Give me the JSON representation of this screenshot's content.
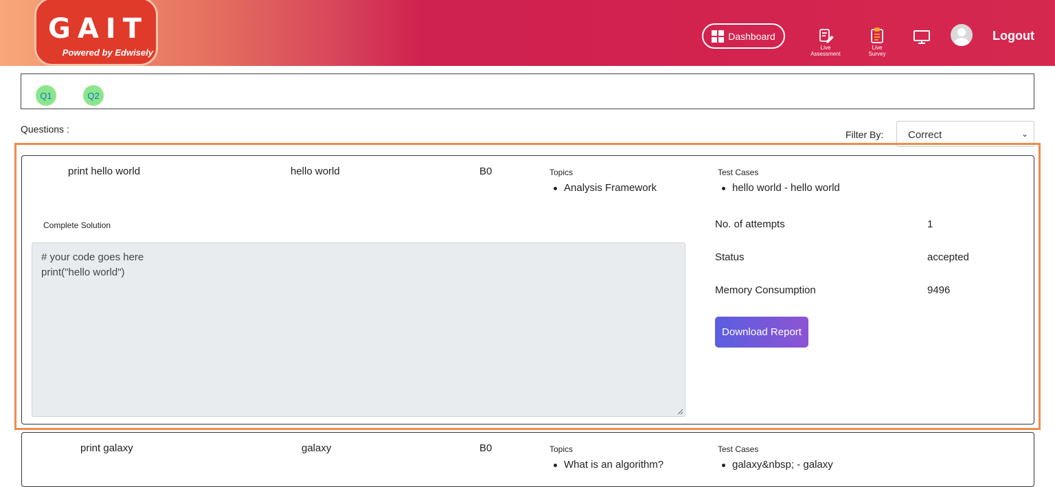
{
  "header": {
    "logo_main": "GAIT",
    "logo_sub": "Powered by Edwisely",
    "nav": {
      "dashboard": "Dashboard",
      "live_assessment_1": "Live",
      "live_assessment_2": "Assessment",
      "live_survey_1": "Live",
      "live_survey_2": "Survey",
      "logout": "Logout"
    }
  },
  "question_nav": [
    "Q1",
    "Q2"
  ],
  "questions_label": "Questions :",
  "filter": {
    "label": "Filter By:",
    "value": "Correct"
  },
  "questions": [
    {
      "title": "print hello world",
      "expected": "hello world",
      "level": "B0",
      "topics_label": "Topics",
      "topics": [
        "Analysis Framework"
      ],
      "test_cases_label": "Test Cases",
      "test_cases": [
        "hello world - hello world"
      ],
      "solution_label": "Complete Solution",
      "code": "# your code goes here\nprint(\"hello world\")",
      "stats": {
        "attempts_label": "No. of attempts",
        "attempts": "1",
        "status_label": "Status",
        "status": "accepted",
        "memory_label": "Memory Consumption",
        "memory": "9496"
      },
      "download_label": "Download Report"
    },
    {
      "title": "print galaxy",
      "expected": "galaxy",
      "level": "B0",
      "topics_label": "Topics",
      "topics": [
        "What is an algorithm?"
      ],
      "test_cases_label": "Test Cases",
      "test_cases": [
        "galaxy&nbsp; - galaxy"
      ]
    }
  ],
  "colors": {
    "accent": "#d2224f",
    "highlight": "#f08a4b",
    "pill": "#8be68b",
    "button": "#6a59dd"
  }
}
